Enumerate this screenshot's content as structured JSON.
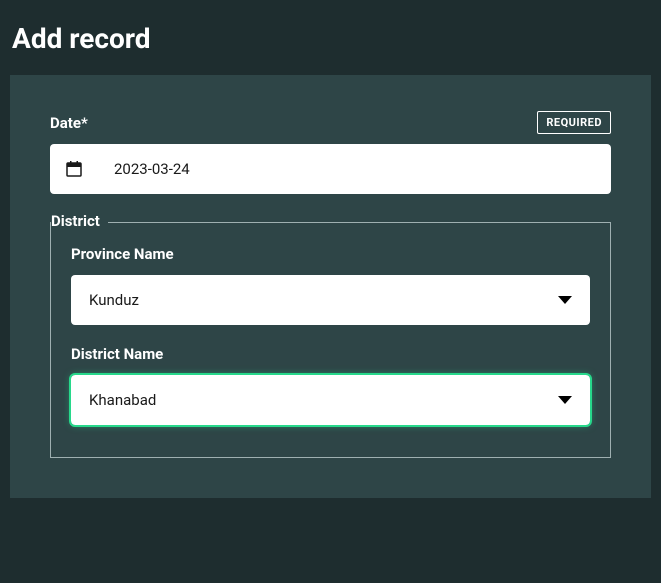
{
  "page": {
    "title": "Add record"
  },
  "form": {
    "date": {
      "label": "Date*",
      "required_badge": "REQUIRED",
      "value": "2023-03-24"
    },
    "district": {
      "legend": "District",
      "province": {
        "label": "Province Name",
        "value": "Kunduz"
      },
      "district_name": {
        "label": "District Name",
        "value": "Khanabad"
      }
    }
  }
}
